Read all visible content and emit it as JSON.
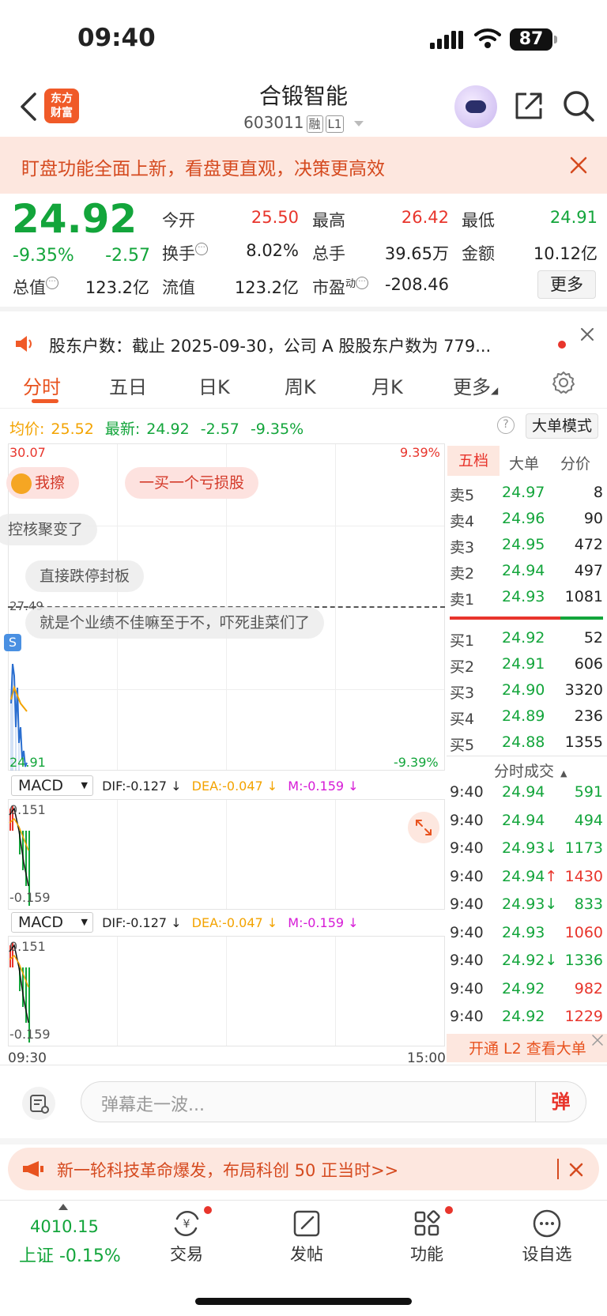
{
  "status_bar": {
    "time": "09:40",
    "battery": "87"
  },
  "header": {
    "logo_line1": "东方",
    "logo_line2": "财富",
    "stock_name": "合锻智能",
    "stock_code": "603011",
    "tag1": "融",
    "tag2": "L1"
  },
  "banner": {
    "text": "盯盘功能全面上新，看盘更直观，决策更高效"
  },
  "quote": {
    "price": "24.92",
    "change_pct": "-9.35%",
    "change": "-2.57",
    "open_label": "今开",
    "open": "25.50",
    "high_label": "最高",
    "high": "26.42",
    "low_label": "最低",
    "low": "24.91",
    "turnover_label": "换手",
    "turnover": "8.02%",
    "volume_label": "总手",
    "volume": "39.65万",
    "amount_label": "金额",
    "amount": "10.12亿",
    "mktcap_label": "总值",
    "mktcap": "123.2亿",
    "float_label": "流值",
    "float": "123.2亿",
    "pe_label": "市盈",
    "pe_sup": "动",
    "pe": "-208.46",
    "more": "更多"
  },
  "notice": {
    "text": "股东户数：截止 2025-09-30，公司 A 股股东户数为 779..."
  },
  "tabs": [
    "分时",
    "五日",
    "日K",
    "周K",
    "月K",
    "更多"
  ],
  "avg_row": {
    "avg_label": "均价:",
    "avg": "25.52",
    "latest_label": "最新:",
    "latest": "24.92",
    "change": "-2.57",
    "pct": "-9.35%",
    "mode_button": "大单模式"
  },
  "chart": {
    "top_price": "30.07",
    "top_pct": "9.39%",
    "mid_price": "27.49",
    "bottom_price": "24.91",
    "bottom_pct": "-9.39%",
    "time_start": "09:30",
    "time_end": "15:00",
    "badge": "S"
  },
  "danmu": [
    "我擦",
    "一买一个亏损股",
    "控核聚变了",
    "直接跌停封板",
    "就是个业绩不佳嘛至于不，吓死韭菜们了"
  ],
  "macd": [
    {
      "name": "MACD",
      "dif": "DIF:-0.127",
      "dea": "DEA:-0.047",
      "m": "M:-0.159",
      "max": "0.151",
      "min": "-0.159"
    },
    {
      "name": "MACD",
      "dif": "DIF:-0.127",
      "dea": "DEA:-0.047",
      "m": "M:-0.159",
      "max": "0.151",
      "min": "-0.159"
    }
  ],
  "order_book": {
    "tabs": [
      "五档",
      "大单",
      "分价"
    ],
    "asks": [
      {
        "label": "卖5",
        "price": "24.97",
        "vol": "8"
      },
      {
        "label": "卖4",
        "price": "24.96",
        "vol": "90"
      },
      {
        "label": "卖3",
        "price": "24.95",
        "vol": "472"
      },
      {
        "label": "卖2",
        "price": "24.94",
        "vol": "497"
      },
      {
        "label": "卖1",
        "price": "24.93",
        "vol": "1081"
      }
    ],
    "bids": [
      {
        "label": "买1",
        "price": "24.92",
        "vol": "52"
      },
      {
        "label": "买2",
        "price": "24.91",
        "vol": "606"
      },
      {
        "label": "买3",
        "price": "24.90",
        "vol": "3320"
      },
      {
        "label": "买4",
        "price": "24.89",
        "vol": "236"
      },
      {
        "label": "买5",
        "price": "24.88",
        "vol": "1355"
      }
    ]
  },
  "trades": {
    "header": "分时成交",
    "rows": [
      {
        "time": "9:40",
        "price": "24.94",
        "arrow": "",
        "vol": "591",
        "dir": "green"
      },
      {
        "time": "9:40",
        "price": "24.94",
        "arrow": "",
        "vol": "494",
        "dir": "green"
      },
      {
        "time": "9:40",
        "price": "24.93",
        "arrow": "↓",
        "vol": "1173",
        "dir": "green"
      },
      {
        "time": "9:40",
        "price": "24.94",
        "arrow": "↑",
        "vol": "1430",
        "dir": "red"
      },
      {
        "time": "9:40",
        "price": "24.93",
        "arrow": "↓",
        "vol": "833",
        "dir": "green"
      },
      {
        "time": "9:40",
        "price": "24.93",
        "arrow": "",
        "vol": "1060",
        "dir": "red"
      },
      {
        "time": "9:40",
        "price": "24.92",
        "arrow": "↓",
        "vol": "1336",
        "dir": "green"
      },
      {
        "time": "9:40",
        "price": "24.92",
        "arrow": "",
        "vol": "982",
        "dir": "red"
      },
      {
        "time": "9:40",
        "price": "24.92",
        "arrow": "",
        "vol": "1229",
        "dir": "red"
      }
    ],
    "l2_text": "开通 L2 查看大单"
  },
  "comment": {
    "placeholder": "弹幕走一波...",
    "button": "弹"
  },
  "promo": {
    "text": "新一轮科技革命爆发，布局科创 50 正当时>>"
  },
  "bottom_nav": {
    "index_value": "4010.15",
    "index_label": "上证 -0.15%",
    "items": [
      "交易",
      "发帖",
      "功能",
      "设自选"
    ]
  }
}
